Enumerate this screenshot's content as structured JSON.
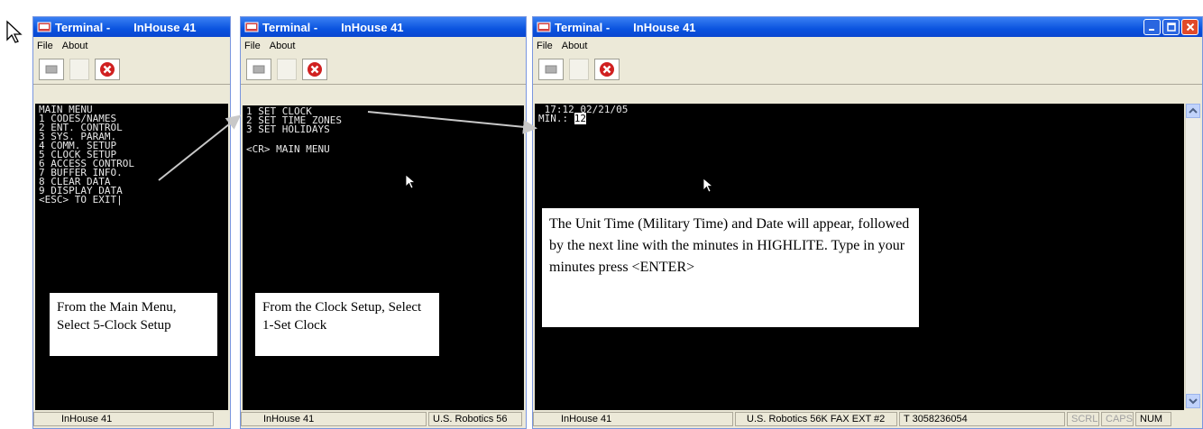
{
  "windows": [
    {
      "title_app": "Terminal -",
      "title_doc": "InHouse 41",
      "menu": [
        "File",
        "About"
      ],
      "screen_lines": [
        "MAIN MENU",
        "",
        "1 CODES/NAMES",
        "2 ENT. CONTROL",
        "3 SYS. PARAM.",
        "4 COMM. SETUP",
        "5 CLOCK SETUP",
        "6 ACCESS CONTROL",
        "7 BUFFER INFO.",
        "8 CLEAR DATA",
        "9 DISPLAY DATA",
        "",
        "<ESC> TO EXIT|"
      ],
      "note": "From the Main Menu, Select 5-Clock Setup",
      "status": [
        "InHouse 41"
      ]
    },
    {
      "title_app": "Terminal -",
      "title_doc": "InHouse 41",
      "menu": [
        "File",
        "About"
      ],
      "screen_lines": [
        "1 SET CLOCK",
        "2 SET TIME ZONES",
        "3 SET HOLIDAYS",
        "",
        "<CR> MAIN MENU"
      ],
      "note": "From the Clock Setup, Select 1-Set Clock",
      "status": [
        "InHouse 41",
        "U.S. Robotics 56"
      ]
    },
    {
      "title_app": "Terminal -",
      "title_doc": "InHouse 41",
      "menu": [
        "File",
        "About"
      ],
      "screen_line1": " 17:12 02/21/05",
      "screen_min_prefix": "MIN.: ",
      "screen_min_value": "12",
      "note": "The Unit Time (Military Time) and Date will appear, followed by the next line with the minutes in HIGHLITE. Type in your minutes press <ENTER>",
      "status": [
        "InHouse 41",
        "U.S. Robotics 56K FAX EXT #2",
        "T 3058236054"
      ],
      "status_flags": [
        "SCRL",
        "CAPS",
        "NUM"
      ]
    }
  ]
}
